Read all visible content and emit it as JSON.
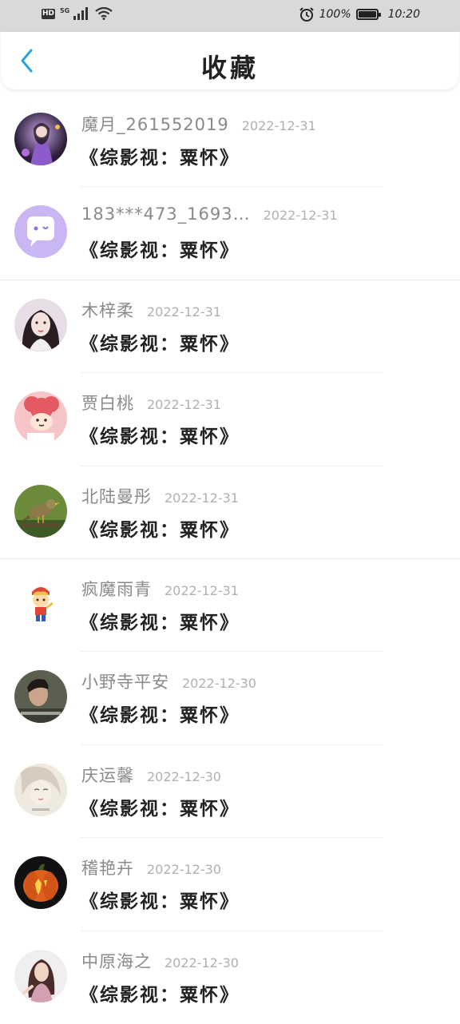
{
  "status_bar": {
    "hd": "HD",
    "network": "5G",
    "battery_percent": "100%",
    "battery_level": 1.0,
    "time": "10:20"
  },
  "header": {
    "title": "收藏",
    "back_icon": "chevron-left-icon"
  },
  "colors": {
    "accent": "#2aa3e0",
    "status_bar_bg": "#d9d9d9"
  },
  "items": [
    {
      "username": "魔月_261552019",
      "date": "2022-12-31",
      "title": "《综影视：粟怀》",
      "avatar": "avatar-fairy"
    },
    {
      "username": "183***473_1693…",
      "date": "2022-12-31",
      "title": "《综影视：粟怀》",
      "avatar": "avatar-chat-bubble"
    },
    {
      "username": "木梓柔",
      "date": "2022-12-31",
      "title": "《综影视：粟怀》",
      "avatar": "avatar-girl-portrait"
    },
    {
      "username": "贾白桃",
      "date": "2022-12-31",
      "title": "《综影视：粟怀》",
      "avatar": "avatar-cartoon-pink"
    },
    {
      "username": "北陆曼彤",
      "date": "2022-12-31",
      "title": "《综影视：粟怀》",
      "avatar": "avatar-bird"
    },
    {
      "username": "疯魔雨青",
      "date": "2022-12-31",
      "title": "《综影视：粟怀》",
      "avatar": "avatar-cartoon-kid"
    },
    {
      "username": "小野寺平安",
      "date": "2022-12-30",
      "title": "《综影视：粟怀》",
      "avatar": "avatar-man-photo"
    },
    {
      "username": "庆运馨",
      "date": "2022-12-30",
      "title": "《综影视：粟怀》",
      "avatar": "avatar-pale-face"
    },
    {
      "username": "稽艳卉",
      "date": "2022-12-30",
      "title": "《综影视：粟怀》",
      "avatar": "avatar-pumpkin"
    },
    {
      "username": "中原海之",
      "date": "2022-12-30",
      "title": "《综影视：粟怀》",
      "avatar": "avatar-woman-photo"
    }
  ]
}
